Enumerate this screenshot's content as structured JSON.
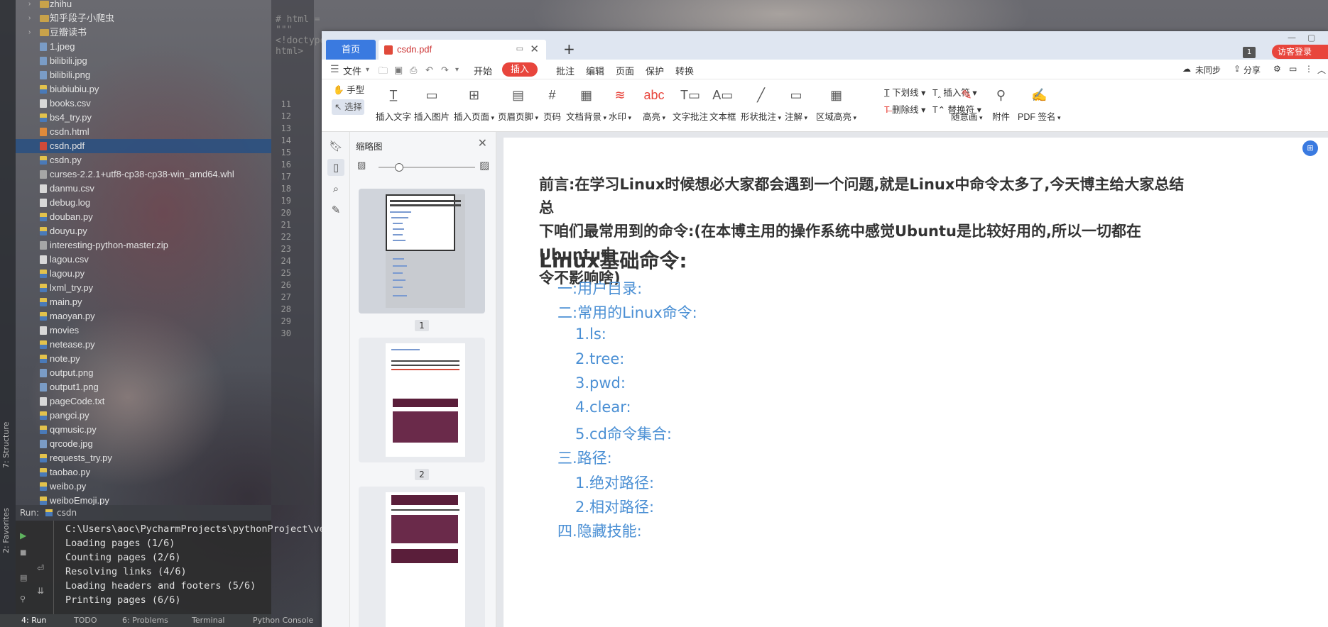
{
  "ide": {
    "project_tree": [
      {
        "name": "zhihu",
        "type": "folder",
        "depth": 1,
        "expand": true
      },
      {
        "name": "知乎段子小爬虫",
        "type": "folder",
        "depth": 1,
        "expand": true
      },
      {
        "name": "豆瓣读书",
        "type": "folder",
        "depth": 1,
        "expand": true
      },
      {
        "name": "1.jpeg",
        "type": "img",
        "depth": 2
      },
      {
        "name": "bilibili.jpg",
        "type": "img",
        "depth": 2
      },
      {
        "name": "bilibili.png",
        "type": "img",
        "depth": 2
      },
      {
        "name": "biubiubiu.py",
        "type": "py",
        "depth": 2
      },
      {
        "name": "books.csv",
        "type": "csv",
        "depth": 2
      },
      {
        "name": "bs4_try.py",
        "type": "py",
        "depth": 2
      },
      {
        "name": "csdn.html",
        "type": "html",
        "depth": 2
      },
      {
        "name": "csdn.pdf",
        "type": "pdf",
        "depth": 2,
        "selected": true
      },
      {
        "name": "csdn.py",
        "type": "py",
        "depth": 2
      },
      {
        "name": "curses-2.2.1+utf8-cp38-cp38-win_amd64.whl",
        "type": "whl",
        "depth": 2
      },
      {
        "name": "danmu.csv",
        "type": "csv",
        "depth": 2
      },
      {
        "name": "debug.log",
        "type": "log",
        "depth": 2
      },
      {
        "name": "douban.py",
        "type": "py",
        "depth": 2
      },
      {
        "name": "douyu.py",
        "type": "py",
        "depth": 2
      },
      {
        "name": "interesting-python-master.zip",
        "type": "zip",
        "depth": 2
      },
      {
        "name": "lagou.csv",
        "type": "csv",
        "depth": 2
      },
      {
        "name": "lagou.py",
        "type": "py",
        "depth": 2
      },
      {
        "name": "lxml_try.py",
        "type": "py",
        "depth": 2
      },
      {
        "name": "main.py",
        "type": "py",
        "depth": 2
      },
      {
        "name": "maoyan.py",
        "type": "py",
        "depth": 2
      },
      {
        "name": "movies",
        "type": "txt",
        "depth": 2
      },
      {
        "name": "netease.py",
        "type": "py",
        "depth": 2
      },
      {
        "name": "note.py",
        "type": "py",
        "depth": 2
      },
      {
        "name": "output.png",
        "type": "img",
        "depth": 2
      },
      {
        "name": "output1.png",
        "type": "img",
        "depth": 2
      },
      {
        "name": "pageCode.txt",
        "type": "txt",
        "depth": 2
      },
      {
        "name": "pangci.py",
        "type": "py",
        "depth": 2
      },
      {
        "name": "qqmusic.py",
        "type": "py",
        "depth": 2
      },
      {
        "name": "qrcode.jpg",
        "type": "img",
        "depth": 2
      },
      {
        "name": "requests_try.py",
        "type": "py",
        "depth": 2
      },
      {
        "name": "taobao.py",
        "type": "py",
        "depth": 2
      },
      {
        "name": "weibo.py",
        "type": "py",
        "depth": 2
      },
      {
        "name": "weiboEmoji.py",
        "type": "py",
        "depth": 2
      }
    ],
    "line_numbers": [
      "11",
      "12",
      "13",
      "14",
      "15",
      "16",
      "17",
      "18",
      "19",
      "20",
      "21",
      "22",
      "23",
      "24",
      "25",
      "26",
      "27",
      "28",
      "29",
      "30"
    ],
    "code_top": "# html = \"\"\"<!doctype html>",
    "run_label": "Run:",
    "run_config": "csdn",
    "console_lines": [
      "C:\\Users\\aoc\\PycharmProjects\\pythonProject\\ven",
      "Loading pages (1/6)",
      "Counting pages (2/6)",
      "Resolving links (4/6)",
      "Loading headers and footers (5/6)",
      "Printing pages (6/6)"
    ],
    "bottom_tabs": [
      "4: Run",
      "TODO",
      "6: Problems",
      "Terminal",
      "Python Console"
    ],
    "side_tabs": [
      "7: Structure",
      "2: Favorites"
    ]
  },
  "pdf": {
    "tab_home": "首页",
    "tab_doc": "csdn.pdf",
    "page_badge": "1",
    "login": "访客登录",
    "menu": {
      "file": "文件",
      "items": [
        "开始",
        "插入",
        "批注",
        "编辑",
        "页面",
        "保护",
        "转换"
      ],
      "active": "插入"
    },
    "right_menu": [
      "未同步",
      "分享"
    ],
    "hand_tool": "手型",
    "select_tool": "选择",
    "tools": [
      "插入文字",
      "插入图片",
      "插入页面",
      "页眉页脚",
      "页码",
      "文档背景",
      "水印",
      "高亮",
      "文字批注",
      "文本框",
      "形状批注",
      "注解",
      "区域高亮"
    ],
    "small_tools": [
      "下划线",
      "删除线",
      "插入符",
      "替换符"
    ],
    "tools2": [
      "随意画",
      "附件",
      "PDF 签名"
    ],
    "thumb_title": "缩略图",
    "thumb_pages": [
      "1",
      "2"
    ],
    "intro": "前言:在学习Linux时候想必大家都会遇到一个问题,就是Linux中命令太多了,今天博主给大家总结总\n下咱们最常用到的命令:(在本博主用的操作系统中感觉Ubuntu是比较好用的,所以一切都在Ubuntu中\n令不影响啥)",
    "heading": "Linux基础命令:",
    "toc": [
      {
        "text": "一:用户目录:",
        "level": 1
      },
      {
        "text": "二:常用的Linux命令:",
        "level": 1
      },
      {
        "text": "1.ls:",
        "level": 2
      },
      {
        "text": "2.tree:",
        "level": 2
      },
      {
        "text": "3.pwd:",
        "level": 2
      },
      {
        "text": "4.clear:",
        "level": 2
      },
      {
        "text": "5.cd命令集合:",
        "level": 2
      },
      {
        "text": "三.路径:",
        "level": 1
      },
      {
        "text": "1.绝对路径:",
        "level": 2
      },
      {
        "text": "2.相对路径:",
        "level": 2
      },
      {
        "text": "四.隐藏技能:",
        "level": 1
      }
    ],
    "colors": {
      "accent": "#3a7ae0",
      "active_menu": "#e8453c",
      "toc_link": "#4a8fd4"
    }
  }
}
